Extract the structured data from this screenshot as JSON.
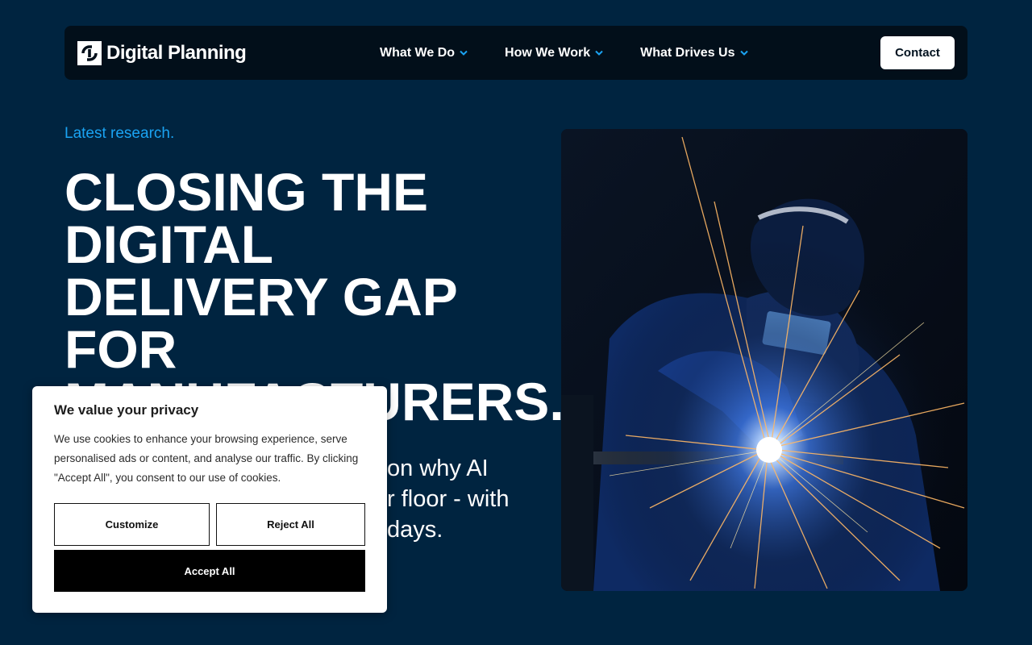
{
  "header": {
    "logo_text": "Digital Planning",
    "nav": [
      {
        "label": "What We Do",
        "icon": "chevron-down-icon"
      },
      {
        "label": "How We Work",
        "icon": "chevron-down-icon"
      },
      {
        "label": "What Drives Us",
        "icon": "chevron-down-icon"
      }
    ],
    "contact_label": "Contact"
  },
  "hero": {
    "eyebrow": "Latest research.",
    "title_lines": [
      "Closing the",
      "Digital",
      "Delivery Gap",
      "for",
      "Manufacturers."
    ],
    "subtitle_visible": [
      "on why AI",
      "r floor - with",
      "days."
    ]
  },
  "image": {
    "subject": "welder-with-sparks-photo"
  },
  "cookie_banner": {
    "title": "We value your privacy",
    "text": "We use cookies to enhance your browsing experience, serve personalised ads or content, and analyse our traffic. By clicking \"Accept All\", you consent to our use of cookies.",
    "customize_label": "Customize",
    "reject_label": "Reject All",
    "accept_label": "Accept All"
  },
  "colors": {
    "background": "#002440",
    "navbar": "#020f1a",
    "accent": "#1aa3f2",
    "cta_bg": "#ffffff"
  }
}
